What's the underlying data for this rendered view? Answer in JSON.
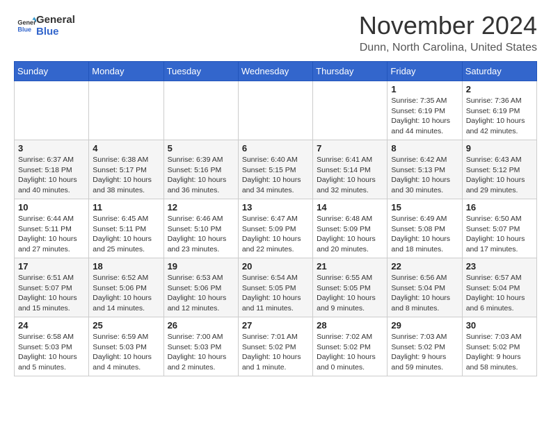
{
  "logo": {
    "line1": "General",
    "line2": "Blue"
  },
  "header": {
    "month": "November 2024",
    "location": "Dunn, North Carolina, United States"
  },
  "weekdays": [
    "Sunday",
    "Monday",
    "Tuesday",
    "Wednesday",
    "Thursday",
    "Friday",
    "Saturday"
  ],
  "weeks": [
    [
      {
        "day": "",
        "info": ""
      },
      {
        "day": "",
        "info": ""
      },
      {
        "day": "",
        "info": ""
      },
      {
        "day": "",
        "info": ""
      },
      {
        "day": "",
        "info": ""
      },
      {
        "day": "1",
        "info": "Sunrise: 7:35 AM\nSunset: 6:19 PM\nDaylight: 10 hours and 44 minutes."
      },
      {
        "day": "2",
        "info": "Sunrise: 7:36 AM\nSunset: 6:19 PM\nDaylight: 10 hours and 42 minutes."
      }
    ],
    [
      {
        "day": "3",
        "info": "Sunrise: 6:37 AM\nSunset: 5:18 PM\nDaylight: 10 hours and 40 minutes."
      },
      {
        "day": "4",
        "info": "Sunrise: 6:38 AM\nSunset: 5:17 PM\nDaylight: 10 hours and 38 minutes."
      },
      {
        "day": "5",
        "info": "Sunrise: 6:39 AM\nSunset: 5:16 PM\nDaylight: 10 hours and 36 minutes."
      },
      {
        "day": "6",
        "info": "Sunrise: 6:40 AM\nSunset: 5:15 PM\nDaylight: 10 hours and 34 minutes."
      },
      {
        "day": "7",
        "info": "Sunrise: 6:41 AM\nSunset: 5:14 PM\nDaylight: 10 hours and 32 minutes."
      },
      {
        "day": "8",
        "info": "Sunrise: 6:42 AM\nSunset: 5:13 PM\nDaylight: 10 hours and 30 minutes."
      },
      {
        "day": "9",
        "info": "Sunrise: 6:43 AM\nSunset: 5:12 PM\nDaylight: 10 hours and 29 minutes."
      }
    ],
    [
      {
        "day": "10",
        "info": "Sunrise: 6:44 AM\nSunset: 5:11 PM\nDaylight: 10 hours and 27 minutes."
      },
      {
        "day": "11",
        "info": "Sunrise: 6:45 AM\nSunset: 5:11 PM\nDaylight: 10 hours and 25 minutes."
      },
      {
        "day": "12",
        "info": "Sunrise: 6:46 AM\nSunset: 5:10 PM\nDaylight: 10 hours and 23 minutes."
      },
      {
        "day": "13",
        "info": "Sunrise: 6:47 AM\nSunset: 5:09 PM\nDaylight: 10 hours and 22 minutes."
      },
      {
        "day": "14",
        "info": "Sunrise: 6:48 AM\nSunset: 5:09 PM\nDaylight: 10 hours and 20 minutes."
      },
      {
        "day": "15",
        "info": "Sunrise: 6:49 AM\nSunset: 5:08 PM\nDaylight: 10 hours and 18 minutes."
      },
      {
        "day": "16",
        "info": "Sunrise: 6:50 AM\nSunset: 5:07 PM\nDaylight: 10 hours and 17 minutes."
      }
    ],
    [
      {
        "day": "17",
        "info": "Sunrise: 6:51 AM\nSunset: 5:07 PM\nDaylight: 10 hours and 15 minutes."
      },
      {
        "day": "18",
        "info": "Sunrise: 6:52 AM\nSunset: 5:06 PM\nDaylight: 10 hours and 14 minutes."
      },
      {
        "day": "19",
        "info": "Sunrise: 6:53 AM\nSunset: 5:06 PM\nDaylight: 10 hours and 12 minutes."
      },
      {
        "day": "20",
        "info": "Sunrise: 6:54 AM\nSunset: 5:05 PM\nDaylight: 10 hours and 11 minutes."
      },
      {
        "day": "21",
        "info": "Sunrise: 6:55 AM\nSunset: 5:05 PM\nDaylight: 10 hours and 9 minutes."
      },
      {
        "day": "22",
        "info": "Sunrise: 6:56 AM\nSunset: 5:04 PM\nDaylight: 10 hours and 8 minutes."
      },
      {
        "day": "23",
        "info": "Sunrise: 6:57 AM\nSunset: 5:04 PM\nDaylight: 10 hours and 6 minutes."
      }
    ],
    [
      {
        "day": "24",
        "info": "Sunrise: 6:58 AM\nSunset: 5:03 PM\nDaylight: 10 hours and 5 minutes."
      },
      {
        "day": "25",
        "info": "Sunrise: 6:59 AM\nSunset: 5:03 PM\nDaylight: 10 hours and 4 minutes."
      },
      {
        "day": "26",
        "info": "Sunrise: 7:00 AM\nSunset: 5:03 PM\nDaylight: 10 hours and 2 minutes."
      },
      {
        "day": "27",
        "info": "Sunrise: 7:01 AM\nSunset: 5:02 PM\nDaylight: 10 hours and 1 minute."
      },
      {
        "day": "28",
        "info": "Sunrise: 7:02 AM\nSunset: 5:02 PM\nDaylight: 10 hours and 0 minutes."
      },
      {
        "day": "29",
        "info": "Sunrise: 7:03 AM\nSunset: 5:02 PM\nDaylight: 9 hours and 59 minutes."
      },
      {
        "day": "30",
        "info": "Sunrise: 7:03 AM\nSunset: 5:02 PM\nDaylight: 9 hours and 58 minutes."
      }
    ]
  ]
}
